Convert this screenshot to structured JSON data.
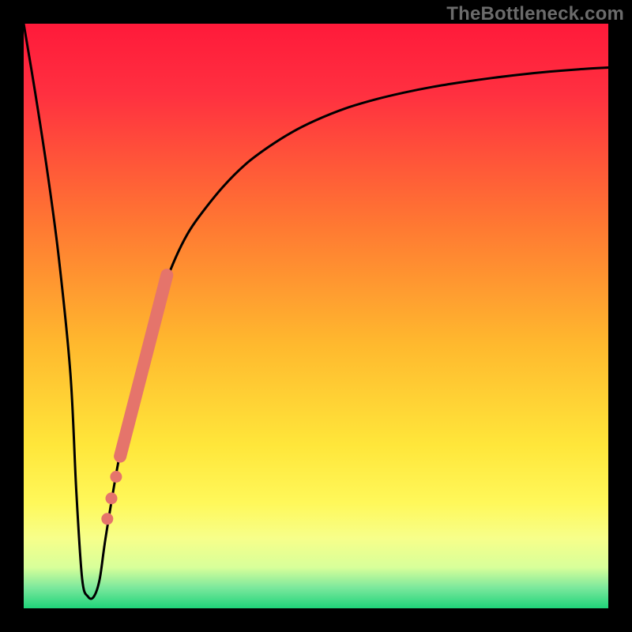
{
  "watermark": "TheBottleneck.com",
  "gradient_stops": [
    {
      "offset": 0.0,
      "color": "#ff1a3a"
    },
    {
      "offset": 0.12,
      "color": "#ff3040"
    },
    {
      "offset": 0.35,
      "color": "#ff7a32"
    },
    {
      "offset": 0.55,
      "color": "#ffb92e"
    },
    {
      "offset": 0.72,
      "color": "#ffe63a"
    },
    {
      "offset": 0.82,
      "color": "#fff85a"
    },
    {
      "offset": 0.88,
      "color": "#f7ff8a"
    },
    {
      "offset": 0.93,
      "color": "#d8ff9a"
    },
    {
      "offset": 0.965,
      "color": "#7be89c"
    },
    {
      "offset": 1.0,
      "color": "#1fd47a"
    }
  ],
  "chart_data": {
    "type": "line",
    "title": "",
    "xlabel": "",
    "ylabel": "",
    "xlim": [
      0,
      100
    ],
    "ylim": [
      0,
      100
    ],
    "series": [
      {
        "name": "bottleneck-curve",
        "color": "#000000",
        "x": [
          0,
          2,
          4,
          6,
          8,
          9,
          10,
          11,
          12,
          13,
          14,
          16,
          18,
          20,
          22,
          24,
          26,
          28,
          30,
          34,
          38,
          42,
          46,
          50,
          55,
          60,
          65,
          70,
          75,
          80,
          85,
          90,
          95,
          100
        ],
        "y": [
          100,
          88,
          75,
          60,
          40,
          20,
          5,
          2,
          2,
          5,
          12,
          24,
          34,
          42,
          49,
          55,
          60,
          64,
          67,
          72,
          76,
          79,
          81.5,
          83.5,
          85.5,
          87,
          88.2,
          89.2,
          90,
          90.7,
          91.3,
          91.8,
          92.2,
          92.5
        ]
      }
    ],
    "highlight_band": {
      "name": "highlight-band",
      "color": "#e5746b",
      "x": [
        16.5,
        24.5
      ],
      "y": [
        26.0,
        57.0
      ]
    },
    "highlight_dots": {
      "name": "highlight-dots",
      "color": "#e5746b",
      "points": [
        {
          "x": 15.8,
          "y": 22.5
        },
        {
          "x": 15.0,
          "y": 18.8
        },
        {
          "x": 14.3,
          "y": 15.3
        }
      ]
    }
  }
}
